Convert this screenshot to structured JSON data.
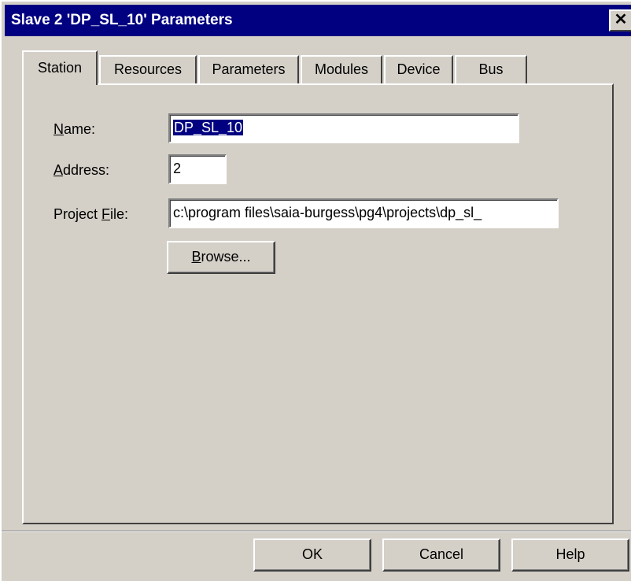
{
  "window": {
    "title": "Slave 2 'DP_SL_10' Parameters",
    "close_glyph": "✕"
  },
  "tabs": [
    {
      "label": "Station",
      "active": true
    },
    {
      "label": "Resources",
      "active": false
    },
    {
      "label": "Parameters",
      "active": false
    },
    {
      "label": "Modules",
      "active": false
    },
    {
      "label": "Device",
      "active": false
    },
    {
      "label": "Bus",
      "active": false
    }
  ],
  "station": {
    "name_label_mnemonic": "N",
    "name_label_rest": "ame:",
    "name_value": "DP_SL_10",
    "address_label_mnemonic": "A",
    "address_label_rest": "ddress:",
    "address_value": "2",
    "project_label_prefix": "Project ",
    "project_label_mnemonic": "F",
    "project_label_rest": "ile:",
    "project_value": "c:\\program files\\saia-burgess\\pg4\\projects\\dp_sl_",
    "browse_mnemonic": "B",
    "browse_rest": "rowse..."
  },
  "buttons": {
    "ok": "OK",
    "cancel": "Cancel",
    "help": "Help"
  }
}
